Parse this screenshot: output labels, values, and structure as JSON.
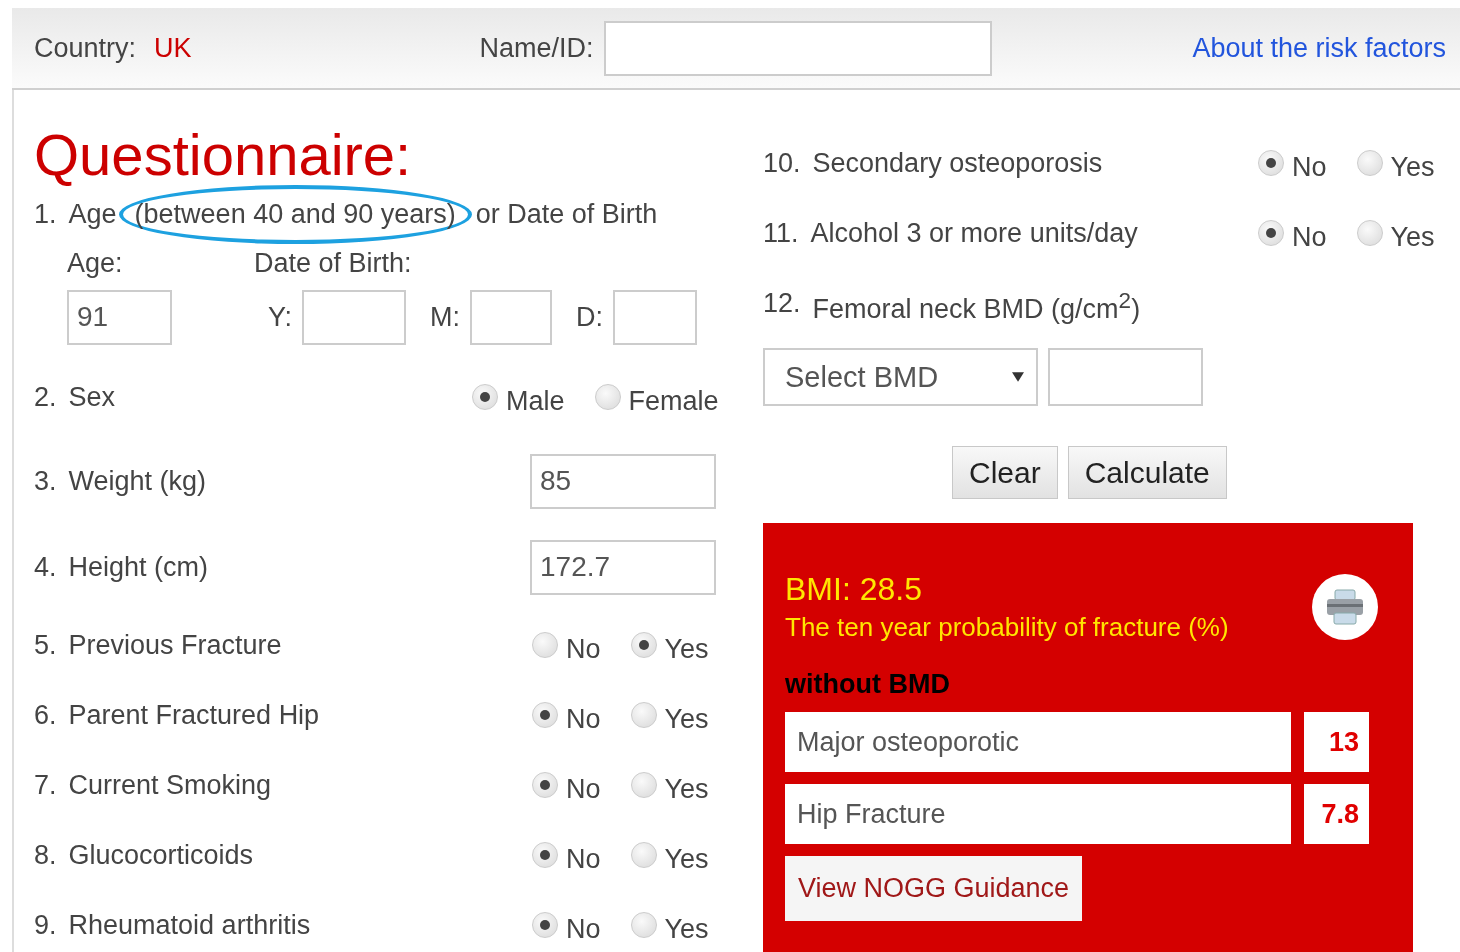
{
  "header": {
    "country_label": "Country:",
    "country": "UK",
    "name_label": "Name/ID:",
    "link": "About the risk factors"
  },
  "title": "Questionnaire:",
  "left_questions": [
    {
      "number": "1.",
      "label": "Age",
      "circled": "(between 40 and 90 years)",
      "label_after": "or Date of Birth",
      "kind": "age",
      "age_label": "Age:",
      "age_value": "91",
      "dob_label": "Date of Birth:",
      "dob_fields": [
        {
          "label": "Y:"
        },
        {
          "label": "M:"
        },
        {
          "label": "D:"
        }
      ]
    },
    {
      "number": "2.",
      "label": "Sex",
      "kind": "radio",
      "options": [
        {
          "label": "Male",
          "selected": true
        },
        {
          "label": "Female",
          "selected": false
        }
      ]
    },
    {
      "number": "3.",
      "label": "Weight (kg)",
      "kind": "input",
      "value": "85"
    },
    {
      "number": "4.",
      "label": "Height (cm)",
      "kind": "input",
      "value": "172.7"
    },
    {
      "number": "5.",
      "label": "Previous Fracture",
      "kind": "radio",
      "options": [
        {
          "label": "No",
          "selected": false
        },
        {
          "label": "Yes",
          "selected": true
        }
      ]
    },
    {
      "number": "6.",
      "label": "Parent Fractured Hip",
      "kind": "radio",
      "options": [
        {
          "label": "No",
          "selected": true
        },
        {
          "label": "Yes",
          "selected": false
        }
      ]
    },
    {
      "number": "7.",
      "label": "Current Smoking",
      "kind": "radio",
      "options": [
        {
          "label": "No",
          "selected": true
        },
        {
          "label": "Yes",
          "selected": false
        }
      ]
    },
    {
      "number": "8.",
      "label": "Glucocorticoids",
      "kind": "radio",
      "options": [
        {
          "label": "No",
          "selected": true
        },
        {
          "label": "Yes",
          "selected": false
        }
      ]
    },
    {
      "number": "9.",
      "label": "Rheumatoid arthritis",
      "kind": "radio",
      "options": [
        {
          "label": "No",
          "selected": true
        },
        {
          "label": "Yes",
          "selected": false
        }
      ]
    }
  ],
  "right_questions": [
    {
      "number": "10.",
      "label": "Secondary osteoporosis",
      "kind": "radio",
      "options": [
        {
          "label": "No",
          "selected": true
        },
        {
          "label": "Yes",
          "selected": false
        }
      ]
    },
    {
      "number": "11.",
      "label": "Alcohol 3 or more units/day",
      "kind": "radio",
      "options": [
        {
          "label": "No",
          "selected": true
        },
        {
          "label": "Yes",
          "selected": false
        }
      ]
    },
    {
      "number": "12.",
      "label": "Femoral neck BMD (g/cm$^{2}$)",
      "kind": "label"
    }
  ],
  "bmd_select": "Select BMD",
  "buttons": [
    "Clear",
    "Calculate"
  ],
  "result": {
    "bmi": "BMI: 28.5",
    "subtitle": "The ten year probability of fracture (%)",
    "section": "without BMD",
    "rows": [
      {
        "label": "Major osteoporotic",
        "value": "13"
      },
      {
        "label": "Hip Fracture",
        "value": "7.8"
      }
    ],
    "guidance_button": "View NOGG Guidance"
  }
}
